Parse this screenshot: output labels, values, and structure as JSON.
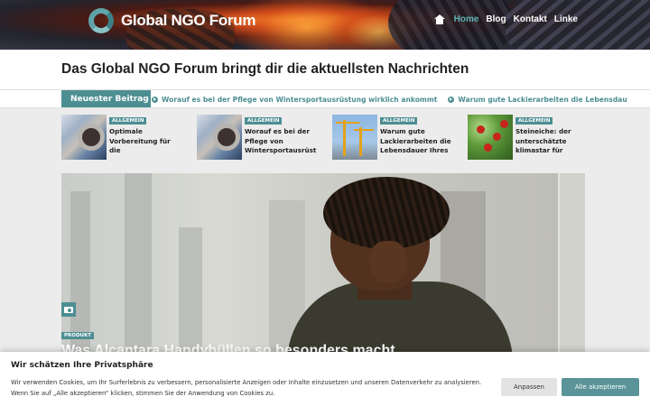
{
  "header": {
    "logo_text": "Global NGO Forum",
    "nav": [
      "Home",
      "Blog",
      "Kontakt",
      "Linke"
    ]
  },
  "headline": "Das Global NGO Forum bringt dir die aktuellsten Nachrichten",
  "ticker": {
    "label": "Neuester Beitrag",
    "items": [
      "Worauf es bei der Pflege von Wintersportausrüstung wirklich ankommt",
      "Warum gute Lackierarbeiten die Lebensdau"
    ]
  },
  "mini_posts": [
    {
      "category": "ALLGEMEIN",
      "title": "Optimale Vorbereitung für die Wintersportsaison"
    },
    {
      "category": "ALLGEMEIN",
      "title": "Worauf es bei der Pflege von Wintersportausrüstun"
    },
    {
      "category": "ALLGEMEIN",
      "title": "Warum gute Lackierarbeiten die Lebensdauer Ihres Krans"
    },
    {
      "category": "ALLGEMEIN",
      "title": "Steineiche: der unterschätzte klimastar für"
    }
  ],
  "hero": {
    "category": "PRODUKT",
    "title": "Was Alcantara Handyhüllen so besonders macht"
  },
  "cookie": {
    "title": "Wir schätzen Ihre Privatsphäre",
    "text": "Wir verwenden Cookies, um Ihr Surferlebnis zu verbessern, personalisierte Anzeigen oder Inhalte einzusetzen und unseren Datenverkehr zu analysieren. Wenn Sie auf „Alle akzeptieren“ klicken, stimmen Sie der Anwendung von Cookies zu.",
    "adjust_label": "Anpassen",
    "accept_label": "Alle akzeptieren"
  },
  "colors": {
    "accent": "#4d8e93",
    "nav_active": "#5fb0b5"
  },
  "icons": [
    "home-icon",
    "camera-icon",
    "ticker-arrow-icon"
  ]
}
